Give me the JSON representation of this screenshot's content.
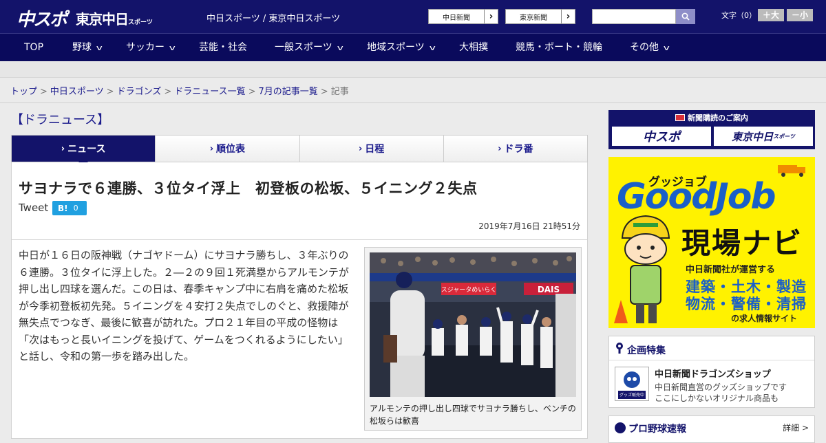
{
  "header": {
    "logo_chuspo": "中スポ",
    "logo_tokyo": "東京中日",
    "logo_tokyo_sub": "スポーツ",
    "site_name": "中日スポーツ / 東京中日スポーツ",
    "link_chunichi": "中日新聞",
    "link_tokyo": "東京新聞",
    "search_placeholder": "",
    "font_size_label": "文字（0）",
    "font_larger": "＋大",
    "font_smaller": "－小"
  },
  "nav": {
    "items": [
      {
        "label": "TOP",
        "has_menu": false
      },
      {
        "label": "野球",
        "has_menu": true
      },
      {
        "label": "サッカー",
        "has_menu": true
      },
      {
        "label": "芸能・社会",
        "has_menu": false
      },
      {
        "label": "一般スポーツ",
        "has_menu": true
      },
      {
        "label": "地域スポーツ",
        "has_menu": true
      },
      {
        "label": "大相撲",
        "has_menu": false
      },
      {
        "label": "競馬・ボート・競輪",
        "has_menu": false
      },
      {
        "label": "その他",
        "has_menu": true
      }
    ]
  },
  "breadcrumb": {
    "items": [
      "トップ",
      "中日スポーツ",
      "ドラゴンズ",
      "ドラニュース一覧",
      "7月の記事一覧"
    ],
    "current": "記事",
    "separator": ">"
  },
  "section_title": "【ドラニュース】",
  "tabs": [
    {
      "label": "ニュース",
      "active": true
    },
    {
      "label": "順位表",
      "active": false
    },
    {
      "label": "日程",
      "active": false
    },
    {
      "label": "ドラ番",
      "active": false
    }
  ],
  "article": {
    "headline": "サヨナラで６連勝、３位タイ浮上　初登板の松坂、５イニング２失点",
    "tweet_label": "Tweet",
    "hatena_label": "B!",
    "hatena_count": "0",
    "date": "2019年7月16日 21時51分",
    "body": "中日が１６日の阪神戦（ナゴヤドーム）にサヨナラ勝ちし、３年ぶりの６連勝。３位タイに浮上した。２―２の９回１死満塁からアルモンテが押し出し四球を選んだ。この日は、春季キャンプ中に右肩を痛めた松坂が今季初登板初先発。５イニングを４安打２失点でしのぐと、救援陣が無失点でつなぎ、最後に歓喜が訪れた。プロ２１年目の平成の怪物は「次はもっと長いイニングを投げて、ゲームをつくれるようにしたい」と話し、令和の第一歩を踏み出した。",
    "photo_caption": "アルモンテの押し出し四球でサヨナラ勝ちし、ベンチの松坂らは歓喜",
    "photo_banner_left": "スジャータめいらく",
    "photo_banner_right": "DAIS"
  },
  "sidebar": {
    "subscription_title": "新聞購読のご案内",
    "sub_chuspo": "中スポ",
    "sub_tokyo": "東京中日",
    "sub_tokyo_small": "スポーツ",
    "ad": {
      "kana": "グッジョブ",
      "brand": "GoodJob",
      "title": "現場ナビ",
      "operator": "中日新聞社が運営する",
      "jobs_line1": "建築・土木・製造",
      "jobs_line2": "物流・警備・清掃",
      "site_desc": "の求人情報サイト"
    },
    "feature": {
      "title": "企画特集",
      "shop_name": "中日新聞ドラゴンズショップ",
      "desc1": "中日新聞直営のグッズショップです",
      "desc2": "ここにしかないオリジナル商品も",
      "thumb_label": "グッズ販売中"
    },
    "scores": {
      "title": "プロ野球速報",
      "more": "詳細 >"
    }
  },
  "colors": {
    "header_bg": "#13136a",
    "nav_bg": "#0a0a5c",
    "link": "#1b1b8c",
    "hatena": "#20a0e0",
    "ad_yellow": "#fff200",
    "ad_blue": "#1a5fc8"
  }
}
